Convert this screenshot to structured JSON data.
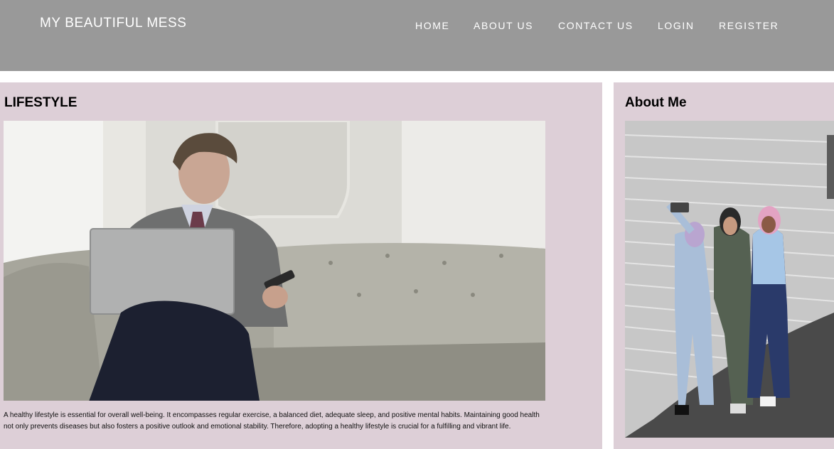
{
  "header": {
    "brand": "MY BEAUTIFUL MESS",
    "nav": [
      {
        "label": "HOME"
      },
      {
        "label": "ABOUT US"
      },
      {
        "label": "CONTACT US"
      },
      {
        "label": "LOGIN"
      },
      {
        "label": "REGISTER"
      }
    ]
  },
  "main": {
    "title": "LIFESTYLE",
    "paragraph": "A healthy lifestyle is essential for overall well-being. It encompasses regular exercise, a balanced diet, adequate sleep, and positive mental habits. Maintaining good health not only prevents diseases but also fosters a positive outlook and emotional stability. Therefore, adopting a healthy lifestyle is crucial for a fulfilling and vibrant life."
  },
  "sidebar": {
    "title": "About Me"
  },
  "colors": {
    "header_bg": "#999999",
    "panel_bg": "#ddcfd7",
    "header_text": "#ffffff"
  }
}
